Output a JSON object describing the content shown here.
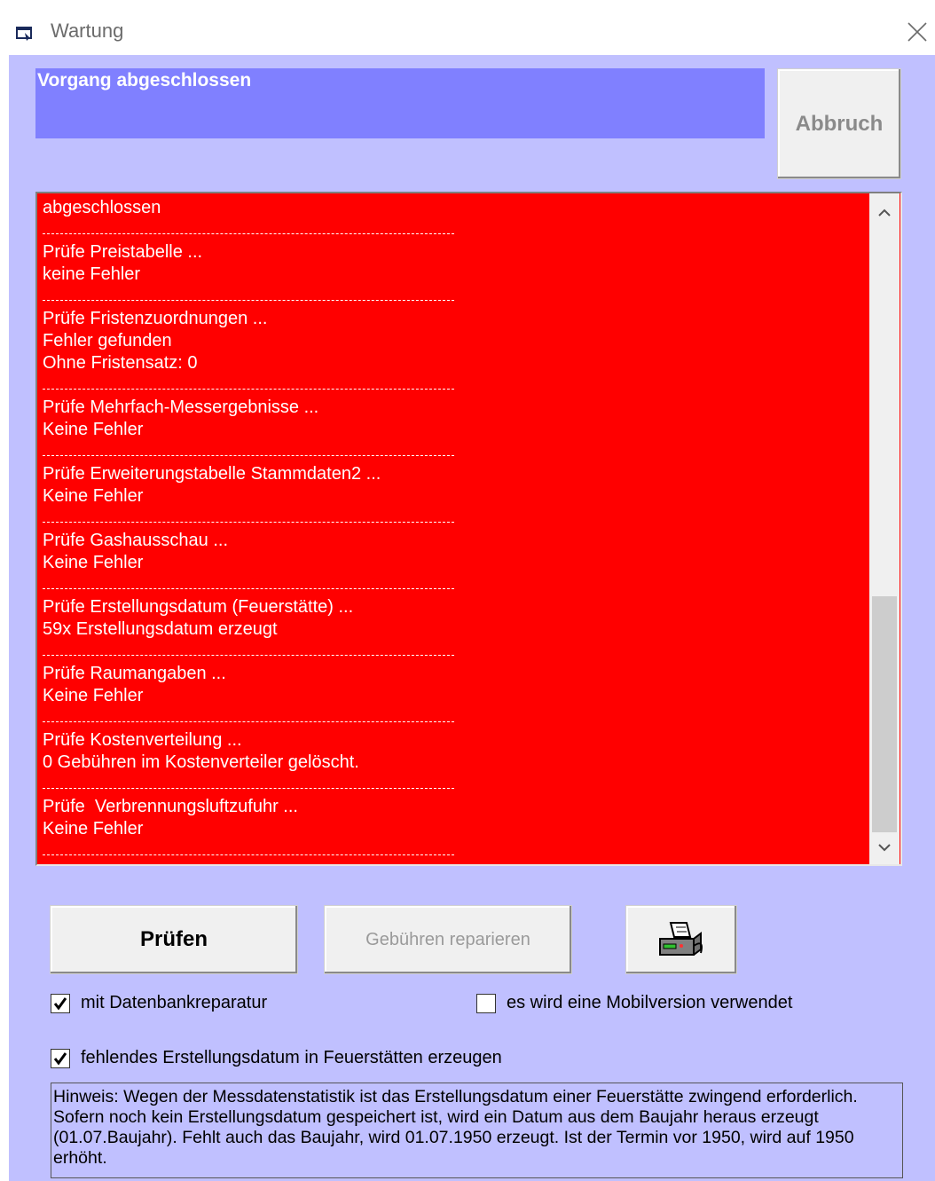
{
  "window": {
    "title": "Wartung",
    "icon": "window-app-icon",
    "close_icon": "close-icon"
  },
  "status": {
    "text": "Vorgang abgeschlossen",
    "color": "#8080ff"
  },
  "buttons": {
    "abbruch": "Abbruch",
    "pruefen": "Prüfen",
    "gebuehren": "Gebühren reparieren",
    "print_icon": "printer-icon"
  },
  "log": {
    "background": "#ff0000",
    "lines": [
      {
        "type": "text",
        "text": "abgeschlossen"
      },
      {
        "type": "sep"
      },
      {
        "type": "text",
        "text": "Prüfe Preistabelle ..."
      },
      {
        "type": "text",
        "text": "keine Fehler"
      },
      {
        "type": "sep"
      },
      {
        "type": "text",
        "text": "Prüfe Fristenzuordnungen ..."
      },
      {
        "type": "text",
        "text": "Fehler gefunden"
      },
      {
        "type": "text",
        "text": "Ohne Fristensatz: 0"
      },
      {
        "type": "sep"
      },
      {
        "type": "text",
        "text": "Prüfe Mehrfach-Messergebnisse ..."
      },
      {
        "type": "text",
        "text": "Keine Fehler"
      },
      {
        "type": "sep"
      },
      {
        "type": "text",
        "text": "Prüfe Erweiterungstabelle Stammdaten2 ..."
      },
      {
        "type": "text",
        "text": "Keine Fehler"
      },
      {
        "type": "sep"
      },
      {
        "type": "text",
        "text": "Prüfe Gashausschau ..."
      },
      {
        "type": "text",
        "text": "Keine Fehler"
      },
      {
        "type": "sep"
      },
      {
        "type": "text",
        "text": "Prüfe Erstellungsdatum (Feuerstätte) ..."
      },
      {
        "type": "text",
        "text": "59x Erstellungsdatum erzeugt"
      },
      {
        "type": "sep"
      },
      {
        "type": "text",
        "text": "Prüfe Raumangaben ..."
      },
      {
        "type": "text",
        "text": "Keine Fehler"
      },
      {
        "type": "sep"
      },
      {
        "type": "text",
        "text": "Prüfe Kostenverteilung ..."
      },
      {
        "type": "text",
        "text": "0 Gebühren im Kostenverteiler gelöscht."
      },
      {
        "type": "sep"
      },
      {
        "type": "text",
        "text": "Prüfe  Verbrennungsluftzufuhr ..."
      },
      {
        "type": "text",
        "text": "Keine Fehler"
      },
      {
        "type": "sep"
      }
    ]
  },
  "options": {
    "db_repair": {
      "label": "mit Datenbankreparatur",
      "checked": true
    },
    "mobile": {
      "label": "es wird eine Mobilversion verwendet",
      "checked": false
    },
    "create_date": {
      "label": "fehlendes Erstellungsdatum in Feuerstätten erzeugen",
      "checked": true
    }
  },
  "hint": {
    "lines": [
      "Hinweis: Wegen der Messdatenstatistik ist das Erstellungsdatum einer Feuerstätte zwingend erforderlich.",
      "Sofern noch kein Erstellungsdatum gespeichert ist, wird ein Datum aus dem Baujahr heraus  erzeugt",
      "(01.07.Baujahr). Fehlt auch das Baujahr, wird 01.07.1950 erzeugt. Ist der Termin vor 1950, wird auf 1950",
      "erhöht."
    ]
  }
}
